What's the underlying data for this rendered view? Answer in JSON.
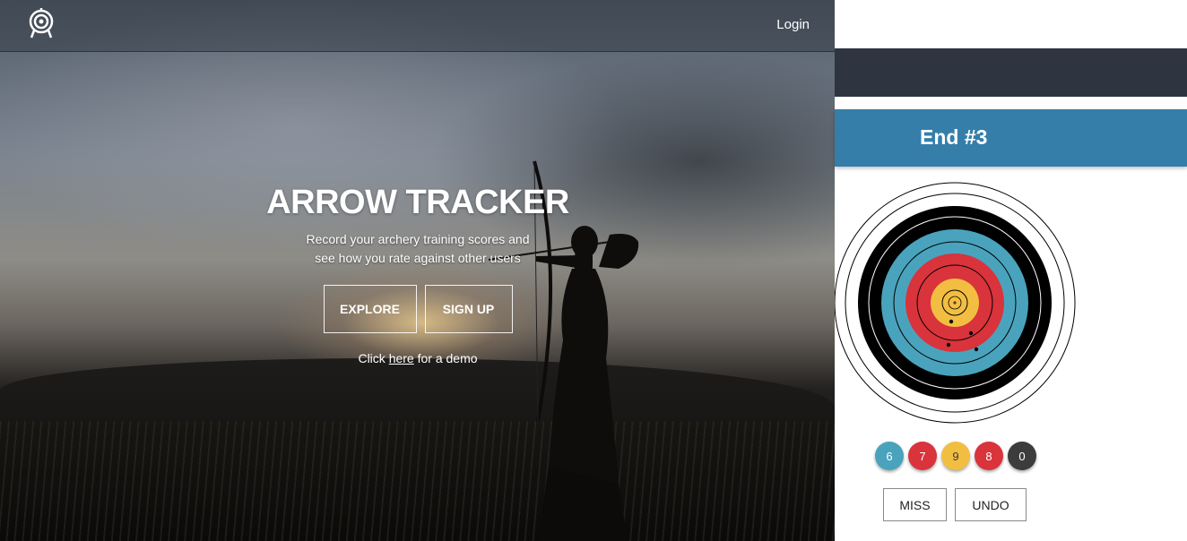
{
  "landing": {
    "nav": {
      "logo_icon": "target-icon",
      "login_label": "Login"
    },
    "hero": {
      "title": "ARROW TRACKER",
      "subtitle_line1": "Record your archery training scores and",
      "subtitle_line2": "see how you rate against other users",
      "explore_label": "EXPLORE",
      "signup_label": "SIGN UP",
      "demo_prefix": "Click",
      "demo_link": "here",
      "demo_suffix": "for a demo"
    }
  },
  "app": {
    "end_title": "End #3",
    "target_colors": {
      "white": "#ffffff",
      "black": "#000000",
      "blue": "#4aa3bd",
      "red": "#d9333c",
      "gold": "#f2be42"
    },
    "scores": [
      {
        "value": "6",
        "color": "#4aa3bd"
      },
      {
        "value": "7",
        "color": "#d9333c"
      },
      {
        "value": "9",
        "color": "#f2be42"
      },
      {
        "value": "8",
        "color": "#d9333c"
      },
      {
        "value": "0",
        "color": "#3c3c3c"
      }
    ],
    "miss_label": "MISS",
    "undo_label": "UNDO"
  }
}
